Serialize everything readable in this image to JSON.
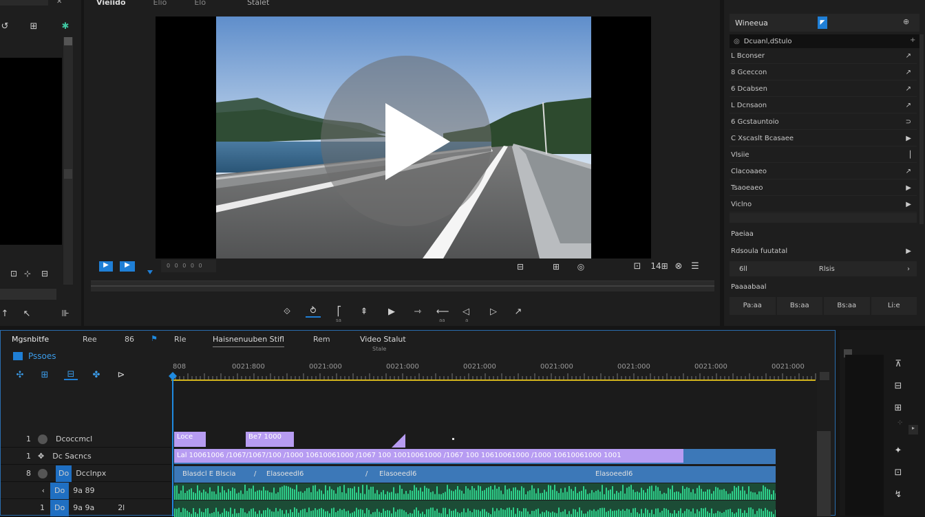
{
  "source_panel": {
    "tool_icons": [
      "loop-icon",
      "grid-icon",
      "color-wheel-icon"
    ],
    "tool_glyphs": [
      "↺",
      "⊞",
      "✱"
    ],
    "bottom_labels": [
      "⊡",
      "⊹",
      "⊟"
    ],
    "nav_glyphs": [
      "↑",
      "↖",
      "⊪"
    ]
  },
  "program": {
    "title": "Vieiido",
    "tabs": [
      "Elio",
      "Elo",
      "Stalet"
    ],
    "timecode": "0 0 0 0 0",
    "left_btns": [
      "▶",
      "▶"
    ],
    "right_icons": [
      "⊟",
      "⊞",
      "◎"
    ],
    "right_icons2": [
      "⊡",
      "14⊞",
      "⊗",
      "☰"
    ],
    "transport": [
      "⟐",
      "⥁",
      "⎡",
      "⇞",
      "▶",
      "⇾",
      "⟵",
      "◁",
      "▷",
      "↗"
    ],
    "sub_labels": [
      "sa",
      "aa",
      "a"
    ]
  },
  "effects": {
    "header": "Wineeua",
    "header_btn": "◤",
    "header_right": "⊕",
    "search_label": "Dcuanl,dStulo",
    "items": [
      {
        "label": "L Bconser",
        "arrow": "↗"
      },
      {
        "label": "8 Gceccon",
        "arrow": "↗"
      },
      {
        "label": "6 Dcabsen",
        "arrow": "↗"
      },
      {
        "label": "L Dcnsaon",
        "arrow": "↗"
      },
      {
        "label": "6 Gcstauntoio",
        "arrow": "⊃"
      },
      {
        "label": "C Xscaslt Bcasaee",
        "arrow": "▶"
      },
      {
        "label": "Vlsiie",
        "arrow": "⎥"
      },
      {
        "label": "Clacoaaeo",
        "arrow": "↗"
      },
      {
        "label": "Tsaoeaeo",
        "arrow": "▶"
      },
      {
        "label": "Viclno",
        "arrow": "▶"
      }
    ],
    "section1": "Paeiaa",
    "section1_row": "Rdsoula fuutatal",
    "section1_row_arrow": "▶",
    "section1_sub": [
      "6ll",
      "Rlsis"
    ],
    "section1_sub_arrow": "›",
    "section2": "Paaaabaal",
    "section2_btns": [
      "Pa:aa",
      "Bs:aa",
      "Bs:aa",
      "Li:e"
    ]
  },
  "timeline": {
    "tabs": [
      "Mgsnbitfe",
      "Ree",
      "86",
      "Rle",
      "Haisnenuuben Stifl",
      "Rem",
      "Video Stalut"
    ],
    "tab_sub": "Stale",
    "sequence_label": "Pssoes",
    "tools": [
      "✣",
      "⊞",
      "⊟",
      "✤",
      "⊳"
    ],
    "ruler_start": "808",
    "ruler_ticks": [
      "0021:800",
      "0021:000",
      "0021:000",
      "0021:000",
      "0021:000",
      "0021:000",
      "0021:000",
      "0021:000"
    ],
    "tracks": [
      {
        "num": "1",
        "name": "Dcoccmcl"
      },
      {
        "num": "1",
        "name": "Dc Sacncs"
      },
      {
        "num": "8",
        "name": "Dcclnpx",
        "badge": "Do"
      },
      {
        "num": "‹",
        "name": "9a  89",
        "badge": "Do"
      },
      {
        "num": "1",
        "name": "9a  9a",
        "badge": "Do",
        "extra": "2l"
      }
    ],
    "clip_small1": "Loce",
    "clip_small2": "Be7 1000",
    "clip_lane2": "Lal 10061006 /1067/1067/100 /1000 10610061000 /1067 100 10010061000 /1067 100 10610061000 /1000 10610061000 1001",
    "clip_lane3_a": "Blasdcl E Blscia",
    "clip_lane3_b": "Elasoeedl6",
    "clip_lane3_c": "Elasoeedl6",
    "clip_lane3_d": "Elasoeedl6"
  },
  "right_tools": [
    "⊼",
    "⊟",
    "⊞",
    "✦",
    "⊡",
    "↯"
  ],
  "colors": {
    "accent": "#1f7fd6",
    "clip_purple": "#b79cf2",
    "clip_blue": "#3c78b8",
    "audio_green": "#2ecf8a",
    "playhead": "#1f8be0",
    "ruler_yellow": "#d4b51c"
  }
}
